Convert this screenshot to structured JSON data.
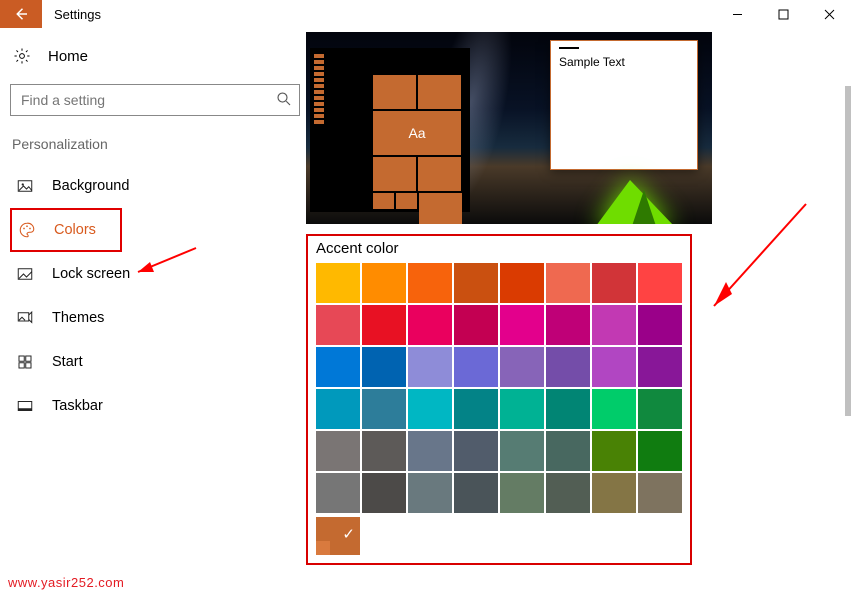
{
  "window": {
    "title": "Settings"
  },
  "home": {
    "label": "Home"
  },
  "search": {
    "placeholder": "Find a setting"
  },
  "section": {
    "label": "Personalization"
  },
  "nav": {
    "items": [
      {
        "label": "Background"
      },
      {
        "label": "Colors"
      },
      {
        "label": "Lock screen"
      },
      {
        "label": "Themes"
      },
      {
        "label": "Start"
      },
      {
        "label": "Taskbar"
      }
    ]
  },
  "preview": {
    "tile_text": "Aa",
    "sample_window_text": "Sample Text"
  },
  "accent": {
    "title": "Accent color",
    "colors": [
      "#ffb900",
      "#ff8c00",
      "#f7630c",
      "#ca5010",
      "#da3b01",
      "#ef6950",
      "#d13438",
      "#ff4343",
      "#e74856",
      "#e81123",
      "#ea005e",
      "#c30052",
      "#e3008c",
      "#bf0077",
      "#c239b3",
      "#9a0089",
      "#0078d7",
      "#0063b1",
      "#8e8cd8",
      "#6b69d6",
      "#8764b8",
      "#744da9",
      "#b146c2",
      "#881798",
      "#0099bc",
      "#2d7d9a",
      "#00b7c3",
      "#038387",
      "#00b294",
      "#018574",
      "#00cc6a",
      "#10893e",
      "#7a7574",
      "#5d5a58",
      "#68768a",
      "#515c6b",
      "#567c73",
      "#486860",
      "#498205",
      "#107c10",
      "#767676",
      "#4c4a48",
      "#69797e",
      "#4a5459",
      "#647c64",
      "#525e54",
      "#847545",
      "#7e735f"
    ],
    "custom_color": "#c46a30"
  },
  "watermark": {
    "text": "www.yasir252.com"
  }
}
